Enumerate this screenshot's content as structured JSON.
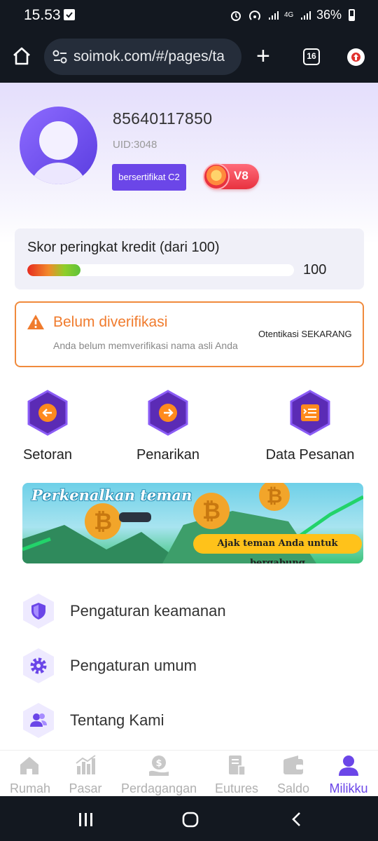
{
  "status_bar": {
    "time": "15.53",
    "network": "4G",
    "battery": "36%"
  },
  "browser": {
    "url": "soimok.com/#/pages/ta",
    "tab_count": "16"
  },
  "profile": {
    "username": "85640117850",
    "uid": "UID:3048",
    "cert_badge": "bersertifikat C2",
    "vip_level": "V8"
  },
  "credit": {
    "title": "Skor peringkat kredit (dari 100)",
    "value": "100",
    "bar_fill_percent": 20
  },
  "verification": {
    "title": "Belum diverifikasi",
    "description": "Anda belum memverifikasi nama asli Anda",
    "action": "Otentikasi SEKARANG"
  },
  "actions": [
    {
      "label": "Setoran",
      "icon": "arrow-left-icon"
    },
    {
      "label": "Penarikan",
      "icon": "arrow-right-icon"
    },
    {
      "label": "Data Pesanan",
      "icon": "list-icon"
    }
  ],
  "banner": {
    "title": "Perkenalkan teman",
    "cta": "Ajak teman Anda untuk bergabung"
  },
  "menu": [
    {
      "label": "Pengaturan keamanan",
      "icon": "shield-icon"
    },
    {
      "label": "Pengaturan umum",
      "icon": "gear-icon"
    },
    {
      "label": "Tentang Kami",
      "icon": "users-icon"
    }
  ],
  "bottom_nav": [
    {
      "label": "Rumah",
      "icon": "home-icon"
    },
    {
      "label": "Pasar",
      "icon": "chart-icon"
    },
    {
      "label": "Perdagangan",
      "icon": "trade-icon"
    },
    {
      "label": "Eutures",
      "icon": "futures-icon"
    },
    {
      "label": "Saldo",
      "icon": "wallet-icon"
    },
    {
      "label": "Milikku",
      "icon": "user-icon"
    }
  ],
  "colors": {
    "accent": "#6b46e8",
    "warning": "#f07b2d",
    "vip": "#e8323f"
  }
}
